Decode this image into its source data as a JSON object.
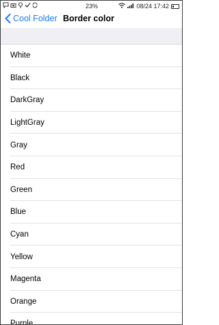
{
  "status_bar": {
    "left_icons": [
      "notification-icon",
      "camera-icon",
      "pin-icon",
      "check-icon",
      "sync-icon"
    ],
    "battery_percent": "23%",
    "datetime": "08/24 17:42",
    "battery_level": 0.23
  },
  "nav": {
    "back_label": "Cool Folder",
    "title": "Border color",
    "accent_color": "#1a7cf5"
  },
  "colors": [
    {
      "label": "White"
    },
    {
      "label": "Black"
    },
    {
      "label": "DarkGray"
    },
    {
      "label": "LightGray"
    },
    {
      "label": "Gray"
    },
    {
      "label": "Red"
    },
    {
      "label": "Green"
    },
    {
      "label": "Blue"
    },
    {
      "label": "Cyan"
    },
    {
      "label": "Yellow"
    },
    {
      "label": "Magenta"
    },
    {
      "label": "Orange"
    },
    {
      "label": "Purple"
    }
  ]
}
